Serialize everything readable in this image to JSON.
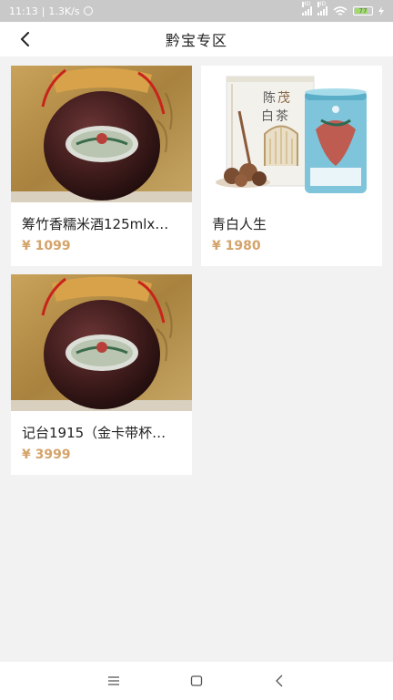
{
  "status_bar": {
    "time": "11:13",
    "network_speed": "1.3K/s",
    "signal_tag_1": "HD",
    "signal_tag_2": "HD",
    "battery": "77",
    "icons": [
      "alarm-icon",
      "signal-icon",
      "signal-icon",
      "wifi-icon",
      "battery-icon",
      "charging-icon"
    ]
  },
  "header": {
    "title": "黔宝专区",
    "back_icon": "chevron-left-icon"
  },
  "products": [
    {
      "name": "筹竹香糯米酒125mlx…",
      "price": "¥ 1099",
      "image": "wine-jar"
    },
    {
      "name": "青白人生",
      "price": "¥ 1980",
      "image": "tea-box"
    },
    {
      "name": "记台1915（金卡带杯…",
      "price": "¥ 3999",
      "image": "wine-jar"
    }
  ],
  "nav_bar": {
    "icons": [
      "menu-icon",
      "home-square-icon",
      "back-triangle-icon"
    ]
  },
  "colors": {
    "price": "#d4a36a",
    "status_bar": "#c9c9c9",
    "background": "#f2f2f2"
  }
}
